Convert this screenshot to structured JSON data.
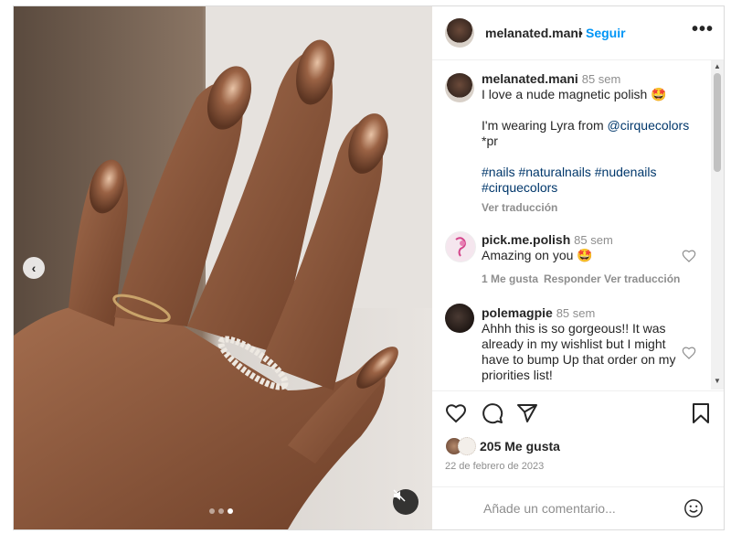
{
  "post": {
    "username": "melanated.mani",
    "follow_label": "Seguir",
    "separator": "•",
    "more_label": "•••",
    "caption": {
      "username": "melanated.mani",
      "time": "85 sem",
      "line1": "I love a nude magnetic polish 🤩",
      "line2a": "I'm wearing Lyra from ",
      "mention": "@cirquecolors",
      "line3": "*pr",
      "hashtags1": "#nails #naturalnails #nudenails",
      "hashtags2": "#cirquecolors",
      "translate": "Ver traducción"
    },
    "comments": [
      {
        "username": "pick.me.polish",
        "time": "85 sem",
        "text": "Amazing on you 🤩",
        "likes": "1 Me gusta",
        "reply": "Responder",
        "translate": "Ver traducción"
      },
      {
        "username": "polemagpie",
        "time": "85 sem",
        "lines": [
          "Ahhh this is so gorgeous!! It was",
          "already in my wishlist but I might",
          "have to bump Up that order on my",
          "priorities list!"
        ]
      }
    ],
    "likes": "205 Me gusta",
    "date": "22 de febrero de 2023",
    "add_comment_placeholder": "Añade un comentario...",
    "carousel": {
      "current": 3,
      "total": 3
    }
  },
  "icons": {
    "heart": "heart-icon",
    "comment": "comment-icon",
    "share": "send-icon",
    "save": "bookmark-icon",
    "emoji": "smiley-icon",
    "mute": "muted-speaker-icon",
    "prev": "chevron-left-icon"
  },
  "colors": {
    "accent": "#0095f6",
    "muted": "#8e8e8e",
    "text": "#262626",
    "link": "#00376b"
  }
}
